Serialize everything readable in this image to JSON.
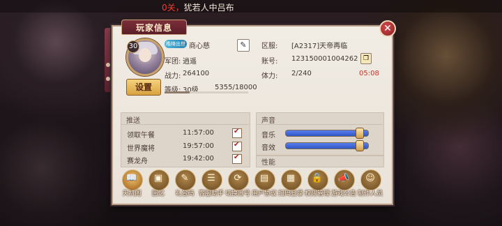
{
  "top_message": {
    "prefix": "0关，",
    "text": "犹若人中吕布"
  },
  "panel": {
    "title": "玩家信息",
    "close_icon": "✕"
  },
  "player": {
    "level": "30",
    "vip_badge": "皓绮出世",
    "name": "商心慈",
    "legion_label": "军团:",
    "legion": "逍遥",
    "power_label": "战力:",
    "power": "264100",
    "level_label": "等级:",
    "level_value": "30级",
    "exp": "5355/18000",
    "exp_progress": 0.2975,
    "settings_label": "设置",
    "server_label": "区服:",
    "server": "[A2317]天帝再临",
    "account_label": "账号:",
    "account": "123150001004262",
    "stamina_label": "体力:",
    "stamina": "2/240",
    "stamina_timer": "05:08"
  },
  "push": {
    "title": "推送",
    "items": [
      {
        "label": "领取午餐",
        "time": "11:57:00",
        "checked": true
      },
      {
        "label": "世界魔将",
        "time": "19:57:00",
        "checked": true
      },
      {
        "label": "赛龙舟",
        "time": "19:42:00",
        "checked": true
      }
    ]
  },
  "sound": {
    "title": "声音",
    "music_label": "音乐",
    "music_level": 0.9,
    "effects_label": "音效",
    "effects_level": 0.9
  },
  "performance": {
    "title": "性能"
  },
  "bottom_buttons": [
    {
      "label": "天机阁",
      "icon": "book-icon",
      "glyph": "📖"
    },
    {
      "label": "回忆",
      "icon": "image-icon",
      "glyph": "▣"
    },
    {
      "label": "礼包码",
      "icon": "gift-icon",
      "glyph": "✎"
    },
    {
      "label": "客服助手",
      "icon": "chat-icon",
      "glyph": "☰"
    },
    {
      "label": "切换账号",
      "icon": "switch-icon",
      "glyph": "⟳"
    },
    {
      "label": "用户协议",
      "icon": "document-icon",
      "glyph": "▤"
    },
    {
      "label": "扫码登录",
      "icon": "qr-icon",
      "glyph": "▦"
    },
    {
      "label": "权限管理",
      "icon": "lock-icon",
      "glyph": "🔒"
    },
    {
      "label": "游戏公告",
      "icon": "megaphone-icon",
      "glyph": "📣"
    },
    {
      "label": "制作人员",
      "icon": "people-icon",
      "glyph": "☺"
    }
  ],
  "colors": {
    "accent_red": "#c4342c",
    "panel_bg": "#f1ece4",
    "title_tab": "#7b2f39",
    "slider_blue": "#2f58c2",
    "button_gold": "#d8a340"
  }
}
